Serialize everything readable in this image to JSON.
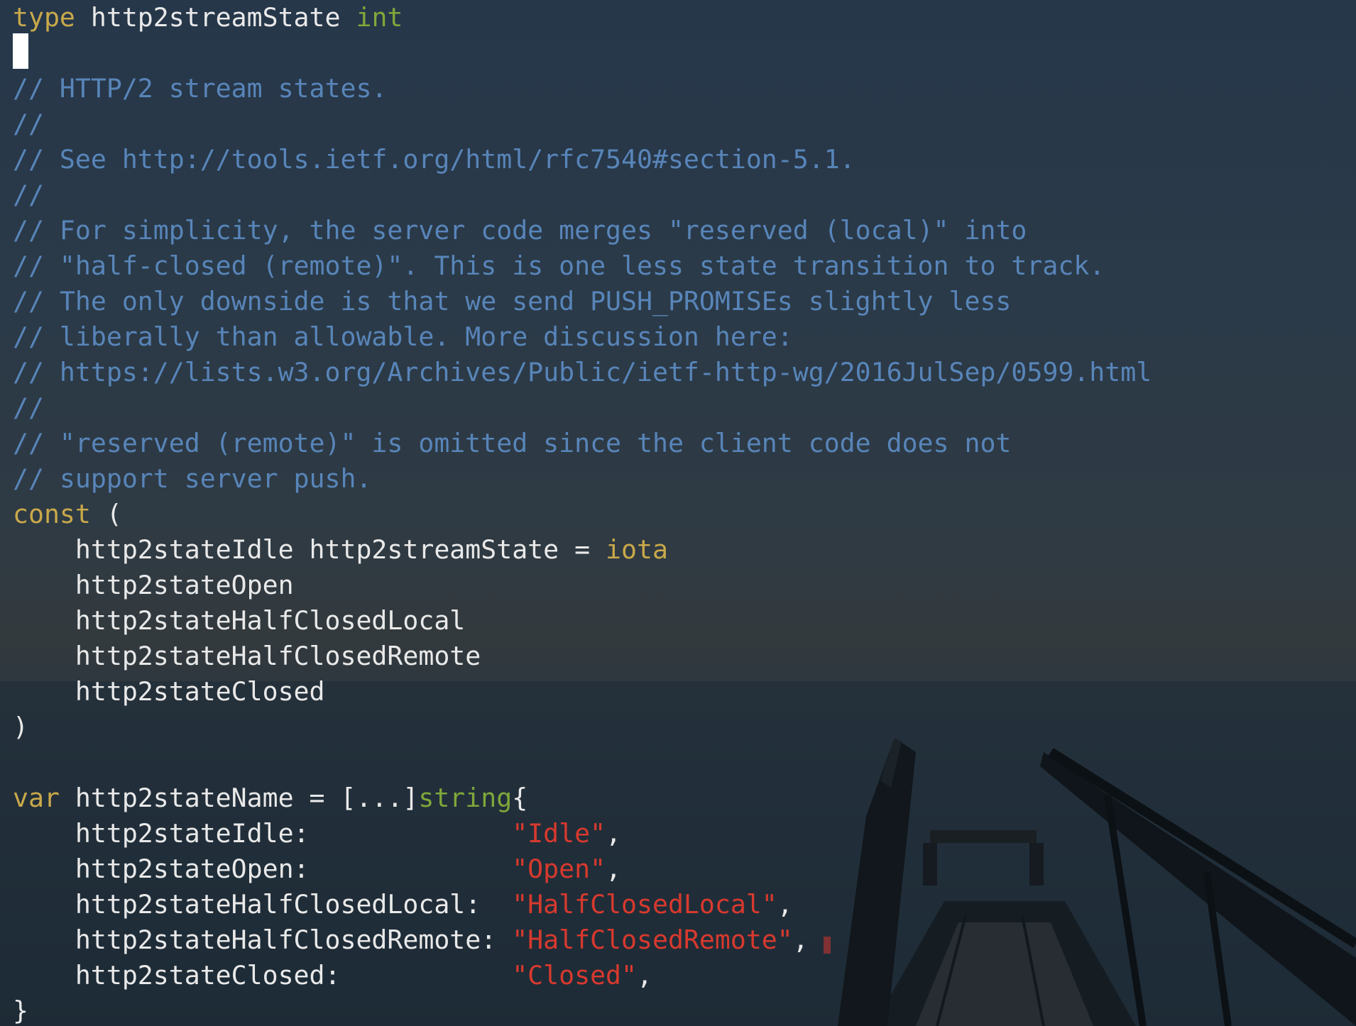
{
  "editor": {
    "lines": [
      [
        {
          "c": "kw",
          "t": "type"
        },
        {
          "c": "id",
          "t": " http2streamState "
        },
        {
          "c": "ty",
          "t": "int"
        }
      ],
      [],
      [
        {
          "c": "cm",
          "t": "// HTTP/2 stream states."
        }
      ],
      [
        {
          "c": "cm",
          "t": "//"
        }
      ],
      [
        {
          "c": "cm",
          "t": "// See http://tools.ietf.org/html/rfc7540#section-5.1."
        }
      ],
      [
        {
          "c": "cm",
          "t": "//"
        }
      ],
      [
        {
          "c": "cm",
          "t": "// For simplicity, the server code merges \"reserved (local)\" into"
        }
      ],
      [
        {
          "c": "cm",
          "t": "// \"half-closed (remote)\". This is one less state transition to track."
        }
      ],
      [
        {
          "c": "cm",
          "t": "// The only downside is that we send PUSH_PROMISEs slightly less"
        }
      ],
      [
        {
          "c": "cm",
          "t": "// liberally than allowable. More discussion here:"
        }
      ],
      [
        {
          "c": "cm",
          "t": "// https://lists.w3.org/Archives/Public/ietf-http-wg/2016JulSep/0599.html"
        }
      ],
      [
        {
          "c": "cm",
          "t": "//"
        }
      ],
      [
        {
          "c": "cm",
          "t": "// \"reserved (remote)\" is omitted since the client code does not"
        }
      ],
      [
        {
          "c": "cm",
          "t": "// support server push."
        }
      ],
      [
        {
          "c": "kw",
          "t": "const"
        },
        {
          "c": "id",
          "t": " ("
        }
      ],
      [
        {
          "c": "id",
          "t": "    http2stateIdle http2streamState = "
        },
        {
          "c": "kw",
          "t": "iota"
        }
      ],
      [
        {
          "c": "id",
          "t": "    http2stateOpen"
        }
      ],
      [
        {
          "c": "id",
          "t": "    http2stateHalfClosedLocal"
        }
      ],
      [
        {
          "c": "id",
          "t": "    http2stateHalfClosedRemote"
        }
      ],
      [
        {
          "c": "id",
          "t": "    http2stateClosed"
        }
      ],
      [
        {
          "c": "id",
          "t": ")"
        }
      ],
      [],
      [
        {
          "c": "kw",
          "t": "var"
        },
        {
          "c": "id",
          "t": " http2stateName = [...]"
        },
        {
          "c": "ty",
          "t": "string"
        },
        {
          "c": "id",
          "t": "{"
        }
      ],
      [
        {
          "c": "id",
          "t": "    http2stateIdle:             "
        },
        {
          "c": "str",
          "t": "\"Idle\""
        },
        {
          "c": "id",
          "t": ","
        }
      ],
      [
        {
          "c": "id",
          "t": "    http2stateOpen:             "
        },
        {
          "c": "str",
          "t": "\"Open\""
        },
        {
          "c": "id",
          "t": ","
        }
      ],
      [
        {
          "c": "id",
          "t": "    http2stateHalfClosedLocal:  "
        },
        {
          "c": "str",
          "t": "\"HalfClosedLocal\""
        },
        {
          "c": "id",
          "t": ","
        }
      ],
      [
        {
          "c": "id",
          "t": "    http2stateHalfClosedRemote: "
        },
        {
          "c": "str",
          "t": "\"HalfClosedRemote\""
        },
        {
          "c": "id",
          "t": ","
        }
      ],
      [
        {
          "c": "id",
          "t": "    http2stateClosed:           "
        },
        {
          "c": "str",
          "t": "\"Closed\""
        },
        {
          "c": "id",
          "t": ","
        }
      ],
      [
        {
          "c": "id",
          "t": "}"
        }
      ]
    ]
  },
  "colors": {
    "keyword": "#c9a94a",
    "type": "#7fa73a",
    "comment": "#5885b9",
    "identifier": "#e9e9e9",
    "string": "#d8392e",
    "cursor": "#ffffff"
  },
  "background": {
    "description_icon": "pier-at-dusk-wallpaper"
  }
}
